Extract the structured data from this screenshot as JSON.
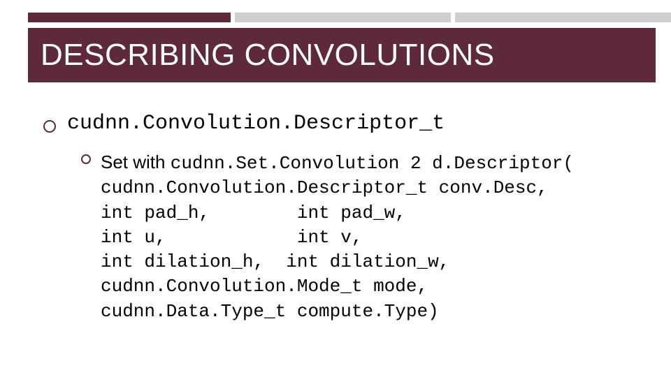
{
  "slide": {
    "title": "DESCRIBING CONVOLUTIONS",
    "bullet1": "cudnn.Convolution.Descriptor_t",
    "bullet2": {
      "prefix": "Set with ",
      "func": "cudnn.Set.Convolution 2 d.Descriptor(",
      "lines": [
        "cudnn.Convolution.Descriptor_t conv.Desc,",
        "int pad_h,        int pad_w,",
        "int u,            int v,",
        "int dilation_h,  int dilation_w,",
        "cudnn.Convolution.Mode_t mode,",
        "cudnn.Data.Type_t compute.Type)"
      ]
    }
  }
}
